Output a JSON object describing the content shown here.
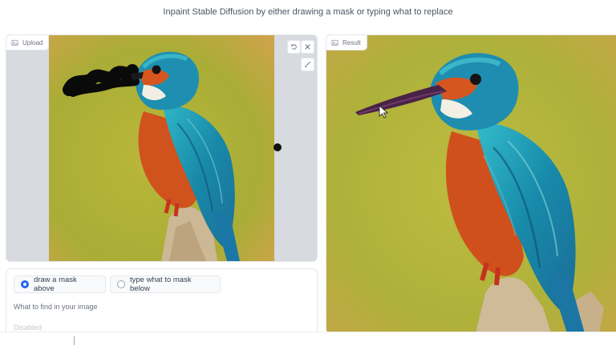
{
  "header": {
    "subtitle": "Inpaint Stable Diffusion by either drawing a mask or typing what to replace"
  },
  "upload_panel": {
    "label": "Upload",
    "label_icon": "image-icon",
    "tools": [
      "undo-icon",
      "close-icon",
      "brush-icon"
    ]
  },
  "result_panel": {
    "label": "Result",
    "label_icon": "image-icon"
  },
  "mask_mode": {
    "options": [
      {
        "label": "draw a mask above",
        "selected": true
      },
      {
        "label": "type what to mask below",
        "selected": false
      }
    ]
  },
  "find": {
    "label": "What to find in your image",
    "placeholder": "Disabled"
  },
  "colors": {
    "accent": "#2563eb",
    "panel_border": "#e5e7eb",
    "kingfisher_blue": "#1aa6b8",
    "kingfisher_orange": "#d2541d",
    "background_green": "#b8bb3f"
  }
}
